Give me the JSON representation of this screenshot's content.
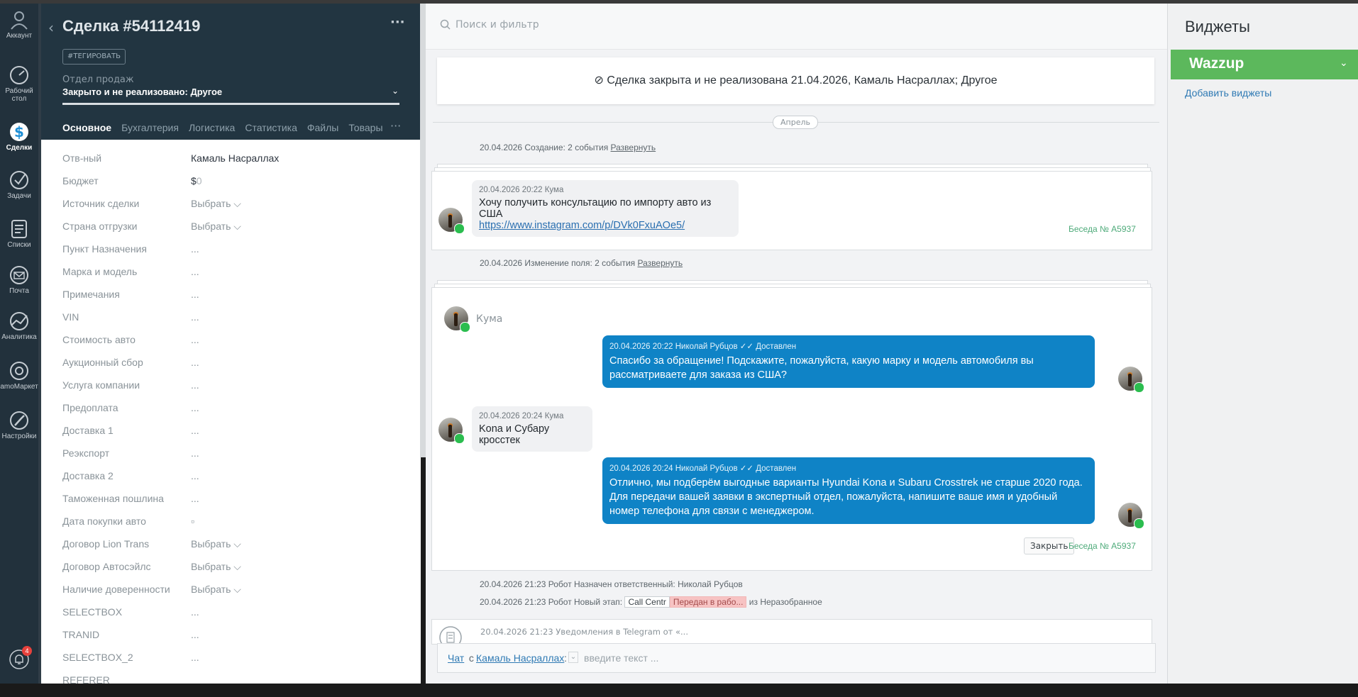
{
  "nav": {
    "items": [
      {
        "label": "Аккаунт",
        "icon": "account-icon"
      },
      {
        "label": "Рабочий стол",
        "icon": "dashboard-icon"
      },
      {
        "label": "Сделки",
        "icon": "deals-icon"
      },
      {
        "label": "Задачи",
        "icon": "tasks-icon"
      },
      {
        "label": "Списки",
        "icon": "lists-icon"
      },
      {
        "label": "Почта",
        "icon": "mail-icon"
      },
      {
        "label": "Аналитика",
        "icon": "analytics-icon"
      },
      {
        "label": "amoМаркет",
        "icon": "market-icon"
      },
      {
        "label": "Настройки",
        "icon": "settings-icon"
      }
    ],
    "notifications_count": "4"
  },
  "deal": {
    "title": "Сделка #54112419",
    "more": "···",
    "tag_button": "#ТЕГИРОВАТЬ",
    "pipeline_label": "Отдел продаж",
    "status_bold": "Закрыто и не реализовано:",
    "status_reason": " Другое",
    "tabs": [
      "Основное",
      "Бухгалтерия",
      "Логистика",
      "Статистика",
      "Файлы",
      "Товары"
    ],
    "tabs_more": "···",
    "fields": [
      {
        "label": "Отв-ный",
        "value": "Камаль Насраллах"
      },
      {
        "label": "Бюджет",
        "value": "$",
        "value_extra": "0"
      },
      {
        "label": "Источник сделки",
        "value": "Выбрать ⌵"
      },
      {
        "label": "Страна отгрузки",
        "value": "Выбрать ⌵"
      },
      {
        "label": "Пункт Назначения",
        "value": "..."
      },
      {
        "label": "Марка и модель",
        "value": "..."
      },
      {
        "label": "Примечания",
        "value": "..."
      },
      {
        "label": "VIN",
        "value": "..."
      },
      {
        "label": "Стоимость авто",
        "value": "..."
      },
      {
        "label": "Аукционный сбор",
        "value": "..."
      },
      {
        "label": "Услуга компании",
        "value": "..."
      },
      {
        "label": "Предоплата",
        "value": "..."
      },
      {
        "label": "Доставка 1",
        "value": "..."
      },
      {
        "label": "Реэкспорт",
        "value": "..."
      },
      {
        "label": "Доставка 2",
        "value": "..."
      },
      {
        "label": "Таможенная пошлина",
        "value": "..."
      },
      {
        "label": "Дата покупки авто",
        "value": "▫"
      },
      {
        "label": "Договор Lion Trans",
        "value": "Выбрать ⌵"
      },
      {
        "label": "Договор Автосэйлс",
        "value": "Выбрать ⌵"
      },
      {
        "label": "Наличие доверенности",
        "value": "Выбрать ⌵"
      },
      {
        "label": "SELECTBOX",
        "value": "..."
      },
      {
        "label": "TRANID",
        "value": "..."
      },
      {
        "label": "SELECTBOX_2",
        "value": "..."
      },
      {
        "label": "REFERER",
        "value": ""
      }
    ]
  },
  "feed": {
    "search_placeholder": "Поиск и фильтр",
    "closed_banner": "Сделка закрыта и не реализована 21.04.2026, Камаль Насраллах; Другое",
    "month": "Апрель",
    "events": {
      "created": "20.04.2026 Создание: 2 события ",
      "changed": "20.04.2026 Изменение поля: 2 события ",
      "expand": "Развернуть",
      "robot_assigned": "20.04.2026 21:23 Робот Назначен ответственный: Николай Рубцов",
      "robot_stage_prefix": "20.04.2026 21:23 Робот Новый этап: ",
      "stage_from": "Call Centr",
      "stage_to": "Передан в рабо...",
      "stage_suffix": " из Неразобранное",
      "telegram": "20.04.2026 21:23 Уведомления в Telegram от «..."
    },
    "msg1": {
      "meta": "20.04.2026 20:22 Кума",
      "text": "Хочу получить консультацию по импорту авто из США",
      "link": "https://www.instagram.com/p/DVk0FxuAOe5/"
    },
    "conv_num": "Беседа № A5937",
    "chat_name": "Кума",
    "out1": {
      "meta": "20.04.2026 20:22 Николай Рубцов ✓✓ Доставлен",
      "text": "Спасибо за обращение! Подскажите, пожалуйста, какую марку и модель автомобиля вы рассматриваете для заказа из США?"
    },
    "in2": {
      "meta": "20.04.2026 20:24 Кума",
      "text": "Kona и Субару кросстек"
    },
    "out2": {
      "meta": "20.04.2026 20:24 Николай Рубцов ✓✓ Доставлен",
      "text": "Отлично, мы подберём выгодные варианты Hyundai Kona и Subaru Crosstrek не старше 2020 года. Для передачи вашей заявки в экспертный отдел, пожалуйста, напишите ваше имя и удобный номер телефона для связи с менеджером."
    },
    "close_button": "Закрыть",
    "chat_bar": {
      "chat": "Чат",
      "with": " с ",
      "contact": "Камаль Насраллах",
      "colon": ":",
      "placeholder": "введите текст ..."
    }
  },
  "widgets": {
    "title": "Виджеты",
    "wazzup": "Wazzup",
    "add": "Добавить виджеты"
  }
}
